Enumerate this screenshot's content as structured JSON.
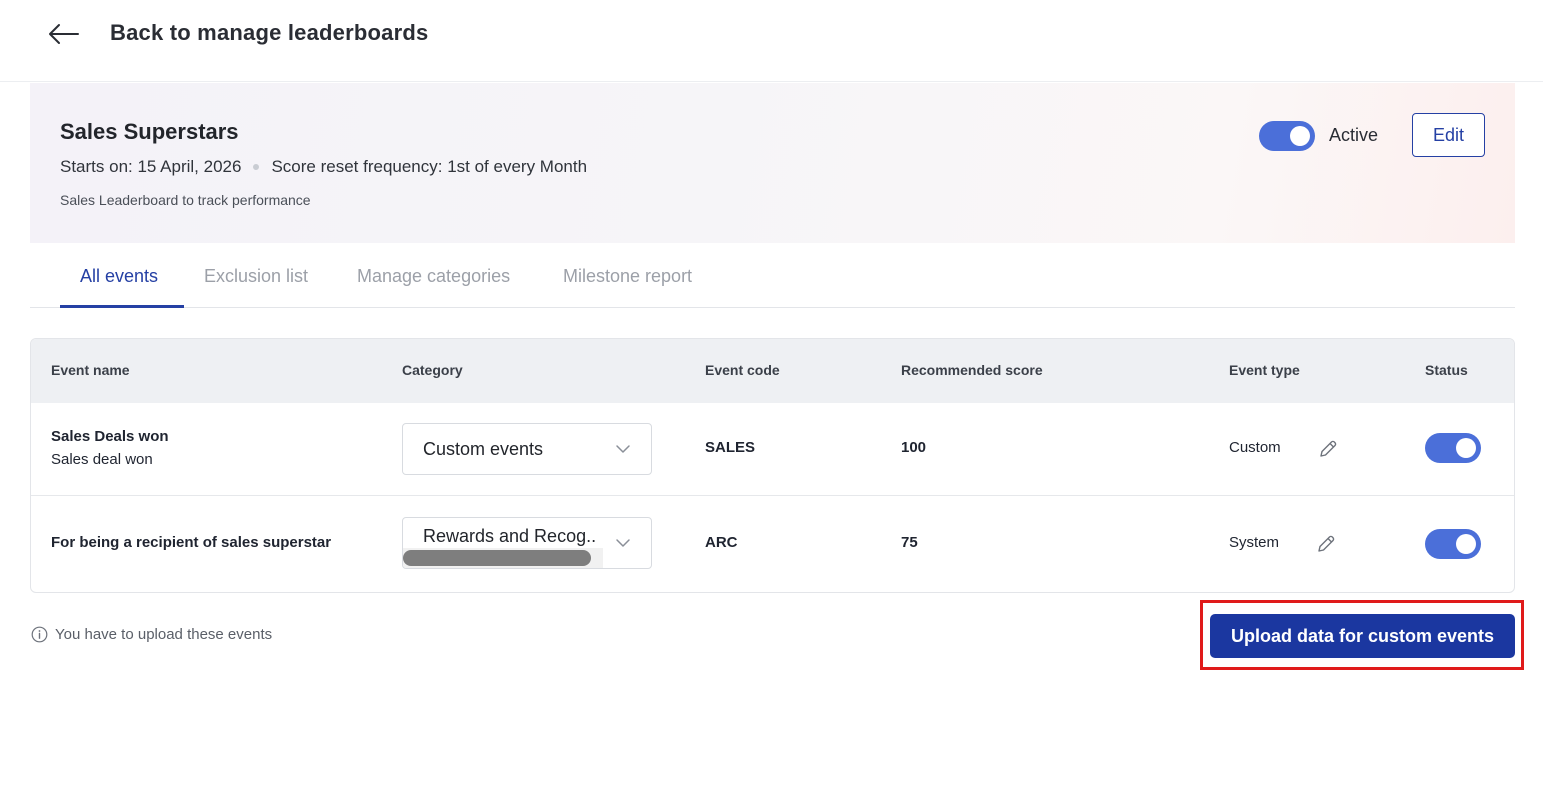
{
  "topbar": {
    "back_icon": "arrow-left-icon",
    "title": "Back to manage leaderboards"
  },
  "leaderboard": {
    "name": "Sales Superstars",
    "starts_on": "Starts on: 15 April, 2026",
    "reset_frequency": "Score reset frequency: 1st of every Month",
    "description": "Sales Leaderboard to track performance",
    "active": true,
    "active_label": "Active",
    "edit_label": "Edit"
  },
  "tabs": [
    {
      "label": "All events",
      "active": true
    },
    {
      "label": "Exclusion list",
      "active": false
    },
    {
      "label": "Manage categories",
      "active": false
    },
    {
      "label": "Milestone report",
      "active": false
    }
  ],
  "table": {
    "columns": [
      "Event name",
      "Category",
      "Event code",
      "Recommended score",
      "Event type",
      "Status"
    ],
    "rows": [
      {
        "event_name": "Sales Deals won",
        "event_subtitle": "Sales deal won",
        "category": "Custom events",
        "event_code": "SALES",
        "recommended_score": "100",
        "event_type": "Custom",
        "status": true
      },
      {
        "event_name": "For being a recipient of sales superstar",
        "event_subtitle": "",
        "category": "Rewards and Recog..",
        "event_code": "ARC",
        "recommended_score": "75",
        "event_type": "System",
        "status": true
      }
    ]
  },
  "footer": {
    "info_icon": "info-circle-icon",
    "info_text": "You have to upload these events",
    "upload_label": "Upload data for custom events"
  },
  "colors": {
    "primary": "#2540a4",
    "button": "#1b37a0",
    "toggle_on": "#4b6fd9",
    "highlight": "#e01a1a"
  }
}
